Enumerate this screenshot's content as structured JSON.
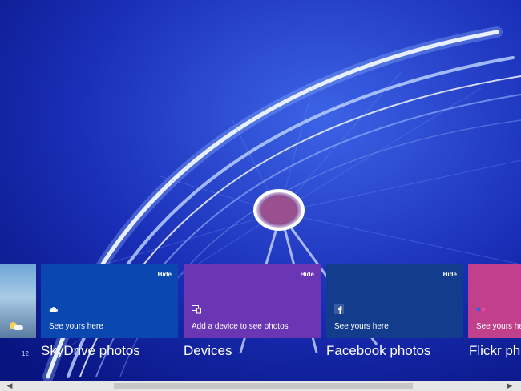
{
  "tiles": [
    {
      "hide": "Hide",
      "text": "See yours here",
      "icon": "skydrive-cloud-icon"
    },
    {
      "hide": "Hide",
      "text": "Add a device to see photos",
      "icon": "devices-icon"
    },
    {
      "hide": "Hide",
      "text": "See yours here",
      "icon": "facebook-icon"
    },
    {
      "text": "See yours here",
      "icon": "flickr-icon"
    }
  ],
  "sections": {
    "skydrive": "SkyDrive photos",
    "devices": "Devices",
    "facebook": "Facebook photos",
    "flickr": "Flickr pho"
  },
  "thumbnail_number": "12",
  "colors": {
    "skydrive": "#0a47b0",
    "devices": "#6a36b4",
    "facebook": "#143c8c",
    "flickr": "#c0408c"
  }
}
